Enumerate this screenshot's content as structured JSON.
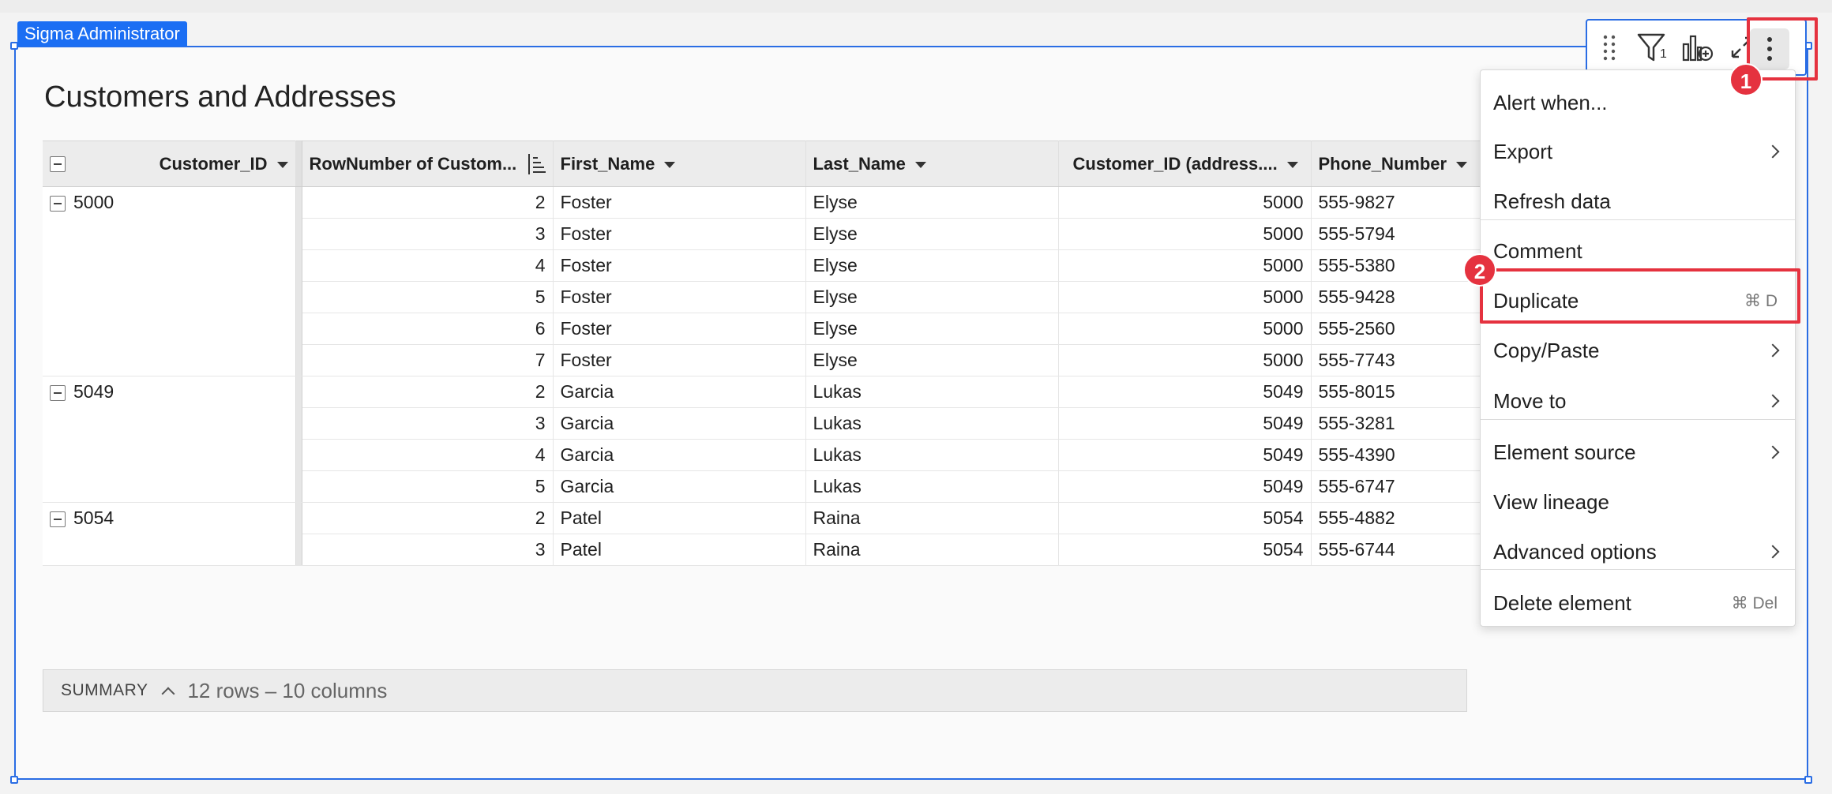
{
  "role_label": "Sigma Administrator",
  "title": "Customers and Addresses",
  "columns": {
    "customer_id": "Customer_ID",
    "row_number": "RowNumber of Custom...",
    "first_name": "First_Name",
    "last_name": "Last_Name",
    "customer_id_address": "Customer_ID (address....",
    "phone_number": "Phone_Number"
  },
  "groups": [
    {
      "id": "5000",
      "rows": [
        {
          "rn": "2",
          "first": "Foster",
          "last": "Elyse",
          "cid": "5000",
          "phone": "555-9827"
        },
        {
          "rn": "3",
          "first": "Foster",
          "last": "Elyse",
          "cid": "5000",
          "phone": "555-5794"
        },
        {
          "rn": "4",
          "first": "Foster",
          "last": "Elyse",
          "cid": "5000",
          "phone": "555-5380"
        },
        {
          "rn": "5",
          "first": "Foster",
          "last": "Elyse",
          "cid": "5000",
          "phone": "555-9428"
        },
        {
          "rn": "6",
          "first": "Foster",
          "last": "Elyse",
          "cid": "5000",
          "phone": "555-2560"
        },
        {
          "rn": "7",
          "first": "Foster",
          "last": "Elyse",
          "cid": "5000",
          "phone": "555-7743"
        }
      ]
    },
    {
      "id": "5049",
      "rows": [
        {
          "rn": "2",
          "first": "Garcia",
          "last": "Lukas",
          "cid": "5049",
          "phone": "555-8015"
        },
        {
          "rn": "3",
          "first": "Garcia",
          "last": "Lukas",
          "cid": "5049",
          "phone": "555-3281"
        },
        {
          "rn": "4",
          "first": "Garcia",
          "last": "Lukas",
          "cid": "5049",
          "phone": "555-4390"
        },
        {
          "rn": "5",
          "first": "Garcia",
          "last": "Lukas",
          "cid": "5049",
          "phone": "555-6747"
        }
      ]
    },
    {
      "id": "5054",
      "rows": [
        {
          "rn": "2",
          "first": "Patel",
          "last": "Raina",
          "cid": "5054",
          "phone": "555-4882"
        },
        {
          "rn": "3",
          "first": "Patel",
          "last": "Raina",
          "cid": "5054",
          "phone": "555-6744"
        }
      ]
    }
  ],
  "summary": {
    "label": "SUMMARY",
    "count": "12 rows – 10 columns"
  },
  "toolbar": {
    "filter_count": "1"
  },
  "menu": {
    "items": [
      {
        "label": "Alert when...",
        "submenu": false,
        "shortcut": ""
      },
      {
        "label": "Export",
        "submenu": true,
        "shortcut": ""
      },
      {
        "label": "Refresh data",
        "submenu": false,
        "shortcut": ""
      },
      {
        "label": "Comment",
        "submenu": false,
        "shortcut": ""
      },
      {
        "label": "Duplicate",
        "submenu": false,
        "shortcut": "⌘ D"
      },
      {
        "label": "Copy/Paste",
        "submenu": true,
        "shortcut": ""
      },
      {
        "label": "Move to",
        "submenu": true,
        "shortcut": ""
      },
      {
        "label": "Element source",
        "submenu": true,
        "shortcut": ""
      },
      {
        "label": "View lineage",
        "submenu": false,
        "shortcut": ""
      },
      {
        "label": "Advanced options",
        "submenu": true,
        "shortcut": ""
      },
      {
        "label": "Delete element",
        "submenu": false,
        "shortcut": "⌘ Del"
      }
    ]
  },
  "callouts": {
    "one": "1",
    "two": "2"
  },
  "colors": {
    "accent": "#1b6ef3",
    "callout": "#e5323f"
  }
}
